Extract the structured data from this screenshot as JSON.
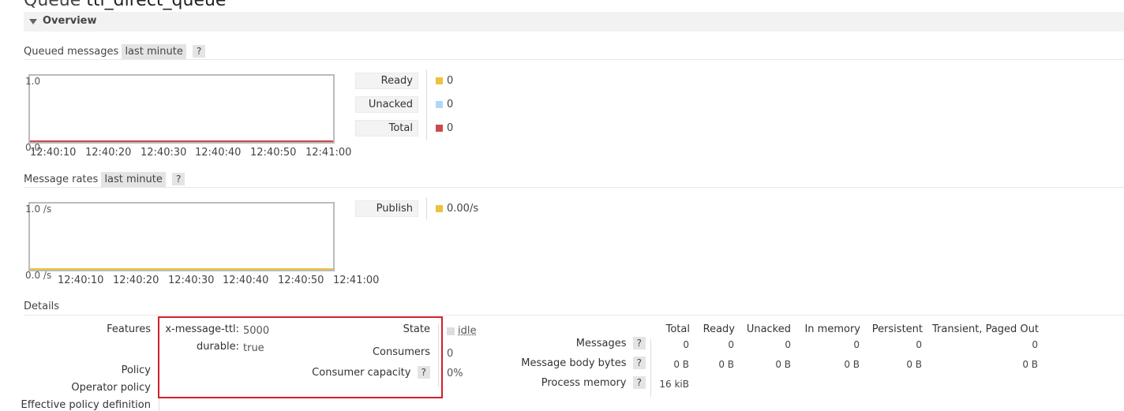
{
  "page": {
    "title_prefix": "Queue",
    "title_name": "ttl_direct_queue",
    "overview_label": "Overview"
  },
  "queued": {
    "heading": "Queued messages",
    "range": "last minute",
    "help": "?",
    "y_top": "1.0",
    "y_bottom": "0.0",
    "x_ticks": [
      "12:40:10",
      "12:40:20",
      "12:40:30",
      "12:40:40",
      "12:40:50",
      "12:41:00"
    ],
    "legend": [
      {
        "label": "Ready",
        "value": "0",
        "color": "#edc240"
      },
      {
        "label": "Unacked",
        "value": "0",
        "color": "#afd8f8"
      },
      {
        "label": "Total",
        "value": "0",
        "color": "#cb4b4b"
      }
    ]
  },
  "rates": {
    "heading": "Message rates",
    "range": "last minute",
    "help": "?",
    "y_top": "1.0 /s",
    "y_bottom": "0.0 /s",
    "x_ticks": [
      "12:40:10",
      "12:40:20",
      "12:40:30",
      "12:40:40",
      "12:40:50",
      "12:41:00"
    ],
    "legend": [
      {
        "label": "Publish",
        "value": "0.00/s",
        "color": "#edc240"
      }
    ]
  },
  "details": {
    "heading": "Details",
    "features_label": "Features",
    "features": [
      {
        "key": "x-message-ttl:",
        "value": "5000"
      },
      {
        "key": "durable:",
        "value": "true"
      }
    ],
    "policy_label": "Policy",
    "operator_policy_label": "Operator policy",
    "effective_policy_label": "Effective policy definition",
    "state_label": "State",
    "state_value": "idle",
    "consumers_label": "Consumers",
    "consumers_value": "0",
    "capacity_label": "Consumer capacity",
    "capacity_help": "?",
    "capacity_value": "0%"
  },
  "stats": {
    "columns": [
      "Total",
      "Ready",
      "Unacked",
      "In memory",
      "Persistent",
      "Transient, Paged Out"
    ],
    "rows": [
      {
        "label": "Messages",
        "help": "?",
        "values": [
          "0",
          "0",
          "0",
          "0",
          "0",
          "0"
        ]
      },
      {
        "label": "Message body bytes",
        "help": "?",
        "values": [
          "0 B",
          "0 B",
          "0 B",
          "0 B",
          "0 B",
          "0 B"
        ]
      },
      {
        "label": "Process memory",
        "help": "?",
        "values": [
          "16 kiB"
        ]
      }
    ]
  }
}
